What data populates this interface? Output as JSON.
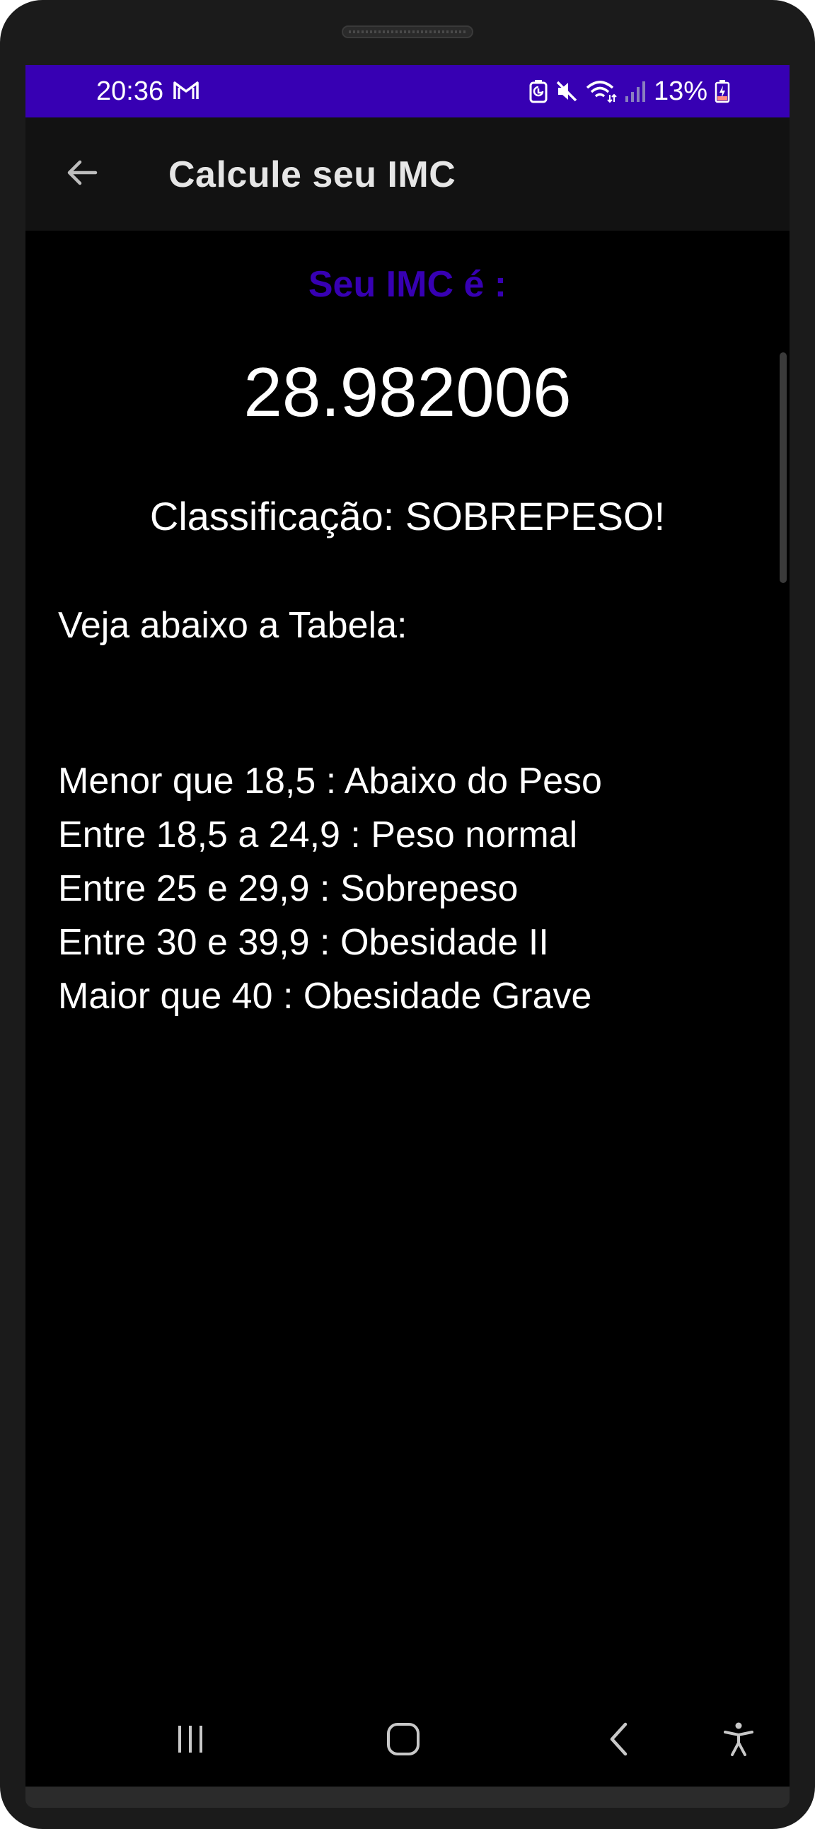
{
  "status_bar": {
    "time": "20:36",
    "battery_percent": "13%",
    "background_color": "#3700b3",
    "icons": [
      "gmail-icon",
      "battery-saver-icon",
      "mute-icon",
      "wifi-icon",
      "signal-icon",
      "battery-charging-icon"
    ]
  },
  "app_bar": {
    "title": "Calcule seu IMC",
    "back_icon": "arrow-back-icon"
  },
  "result": {
    "label": "Seu IMC é :",
    "label_color": "#3700b3",
    "value": "28.982006",
    "classification": "Classificação: SOBREPESO!"
  },
  "table": {
    "intro": "Veja abaixo a Tabela:",
    "rows": [
      "Menor que 18,5 : Abaixo do Peso",
      "Entre 18,5 a 24,9 : Peso normal",
      "Entre 25 e 29,9 : Sobrepeso",
      "Entre 30 e 39,9 : Obesidade II",
      "Maior que 40 : Obesidade Grave"
    ]
  },
  "nav_bar": {
    "icons": [
      "recent-apps-icon",
      "home-icon",
      "back-icon",
      "accessibility-icon"
    ]
  }
}
